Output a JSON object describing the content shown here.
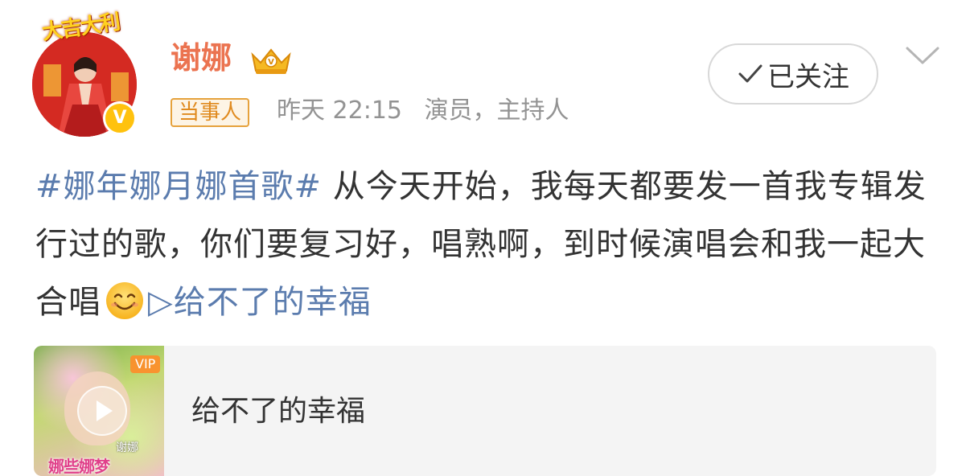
{
  "user": {
    "name": "谢娜",
    "tag": "当事人",
    "time": "昨天 22:15",
    "occupation": "演员，主持人",
    "avatar_banner_text": "大吉大利",
    "verified_badge": "V"
  },
  "actions": {
    "follow_label": "已关注",
    "follow_icon": "check-icon",
    "more_icon": "chevron-down-icon"
  },
  "post": {
    "hashtag": "#娜年娜月娜首歌#",
    "text_part1": " 从今天开始，我每天都要发一首我专辑发行过的歌，你们要复习好，唱熟啊，到时候演唱会和我一起大合唱",
    "emoji": "smile-emoji",
    "music_link_icon": "▷",
    "music_link_text": "给不了的幸福"
  },
  "media_card": {
    "title": "给不了的幸福",
    "vip_label": "VIP",
    "cover_artist": "谢娜",
    "cover_album": "娜些娜梦",
    "play_icon": "play-icon"
  },
  "colors": {
    "username": "#eb7350",
    "link": "#5b7cae",
    "meta": "#939393",
    "tag_border": "#e6a23c",
    "verified": "#ffc20e"
  }
}
